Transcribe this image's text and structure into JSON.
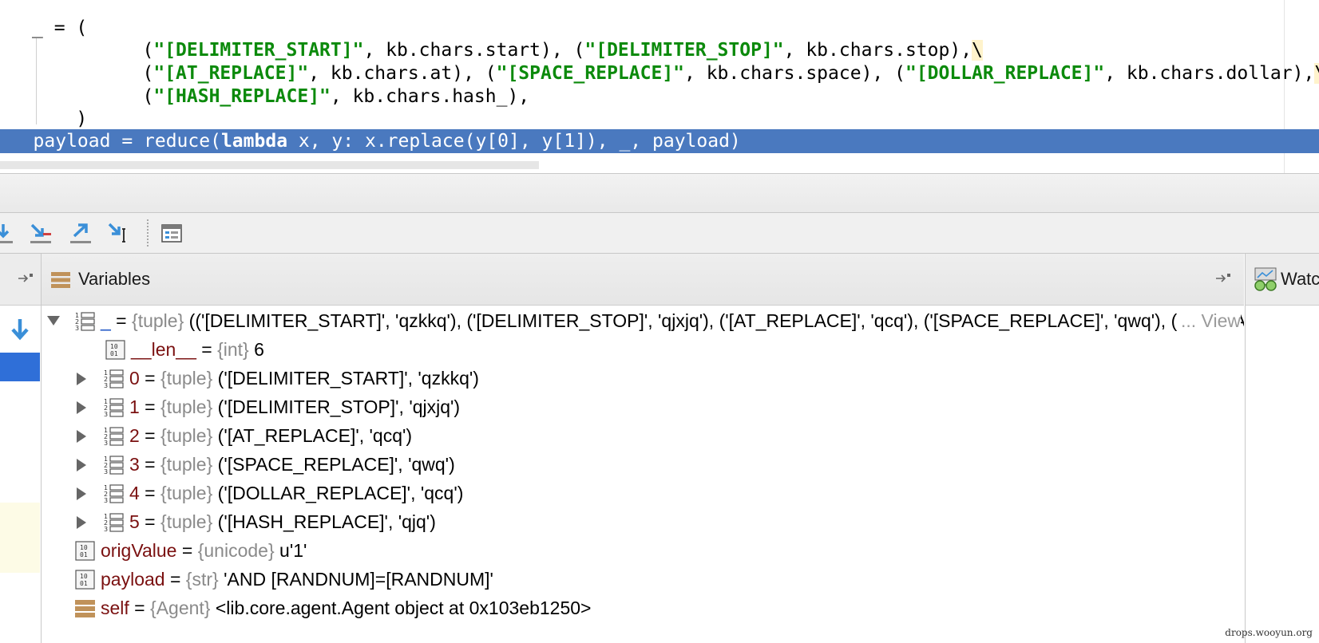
{
  "editor": {
    "lines": [
      [
        {
          "t": "_ = ("
        }
      ],
      [
        {
          "t": "          ("
        },
        {
          "t": "\"[DELIMITER_START]\"",
          "c": "str"
        },
        {
          "t": ", kb.chars.start), ("
        },
        {
          "t": "\"[DELIMITER_STOP]\"",
          "c": "str"
        },
        {
          "t": ", kb.chars.stop),"
        },
        {
          "t": "\\",
          "c": "bs"
        }
      ],
      [
        {
          "t": "          ("
        },
        {
          "t": "\"[AT_REPLACE]\"",
          "c": "str"
        },
        {
          "t": ", kb.chars.at), ("
        },
        {
          "t": "\"[SPACE_REPLACE]\"",
          "c": "str"
        },
        {
          "t": ", kb.chars.space), ("
        },
        {
          "t": "\"[DOLLAR_REPLACE]\"",
          "c": "str"
        },
        {
          "t": ", kb.chars.dollar),"
        },
        {
          "t": "\\",
          "c": "bs"
        }
      ],
      [
        {
          "t": "          ("
        },
        {
          "t": "\"[HASH_REPLACE]\"",
          "c": "str"
        },
        {
          "t": ", kb.chars.hash_),"
        }
      ],
      [
        {
          "t": "    )"
        }
      ],
      [
        {
          "t": "   payload = reduce("
        },
        {
          "t": "lambda",
          "c": "kw"
        },
        {
          "t": " x, y: x.replace(y[0], y[1]), _, payload)"
        }
      ]
    ],
    "current_line": 5
  },
  "variables": {
    "title": "Variables",
    "rows": [
      {
        "toggle": "expanded",
        "icon": "list",
        "name": "_",
        "name_style": "link",
        "type": "{tuple}",
        "value": "(('[DELIMITER_START]', 'qzkkq'), ('[DELIMITER_STOP]', 'qjxjq'), ('[AT_REPLACE]', 'qcq'), ('[SPACE_REPLACE]', 'qwq'), ('[DOLLAR_REPLACE]', 'qcq'), ('[HASH_REPLACE]', 'qjq'))",
        "more": "... View",
        "depth": 0
      },
      {
        "toggle": "none",
        "icon": "primitive",
        "name": "__len__",
        "type": "{int}",
        "value": "6",
        "depth": 1
      },
      {
        "toggle": "collapsed",
        "icon": "list",
        "name": "0",
        "type": "{tuple}",
        "value": "('[DELIMITER_START]', 'qzkkq')",
        "depth": 1
      },
      {
        "toggle": "collapsed",
        "icon": "list",
        "name": "1",
        "type": "{tuple}",
        "value": "('[DELIMITER_STOP]', 'qjxjq')",
        "depth": 1
      },
      {
        "toggle": "collapsed",
        "icon": "list",
        "name": "2",
        "type": "{tuple}",
        "value": "('[AT_REPLACE]', 'qcq')",
        "depth": 1
      },
      {
        "toggle": "collapsed",
        "icon": "list",
        "name": "3",
        "type": "{tuple}",
        "value": "('[SPACE_REPLACE]', 'qwq')",
        "depth": 1
      },
      {
        "toggle": "collapsed",
        "icon": "list",
        "name": "4",
        "type": "{tuple}",
        "value": "('[DOLLAR_REPLACE]', 'qcq')",
        "depth": 1
      },
      {
        "toggle": "collapsed",
        "icon": "list",
        "name": "5",
        "type": "{tuple}",
        "value": "('[HASH_REPLACE]', 'qjq')",
        "depth": 1
      },
      {
        "toggle": "none",
        "icon": "primitive",
        "name": "origValue",
        "type": "{unicode}",
        "value": "u'1'",
        "depth": 0
      },
      {
        "toggle": "none",
        "icon": "primitive",
        "name": "payload",
        "type": "{str}",
        "value": "'AND [RANDNUM]=[RANDNUM]'",
        "depth": 0
      },
      {
        "toggle": "none",
        "icon": "object",
        "name": "self",
        "type": "{Agent}",
        "value": "<lib.core.agent.Agent object at 0x103eb1250>",
        "depth": 0
      }
    ]
  },
  "toolbar": {
    "icons": [
      "step-over-icon",
      "step-into-icon",
      "force-step-into-icon",
      "step-out-icon",
      "run-to-cursor-icon",
      "evaluate-expression-icon"
    ]
  },
  "watches": {
    "title": "Watches"
  },
  "watermark": "drops.wooyun.org",
  "colors": {
    "selection": "#4a79bf",
    "string_literal": "#0c8a0c",
    "var_name": "#7a1010",
    "type_hint": "#8a8a8a",
    "frame_selected": "#2f6fd8"
  }
}
